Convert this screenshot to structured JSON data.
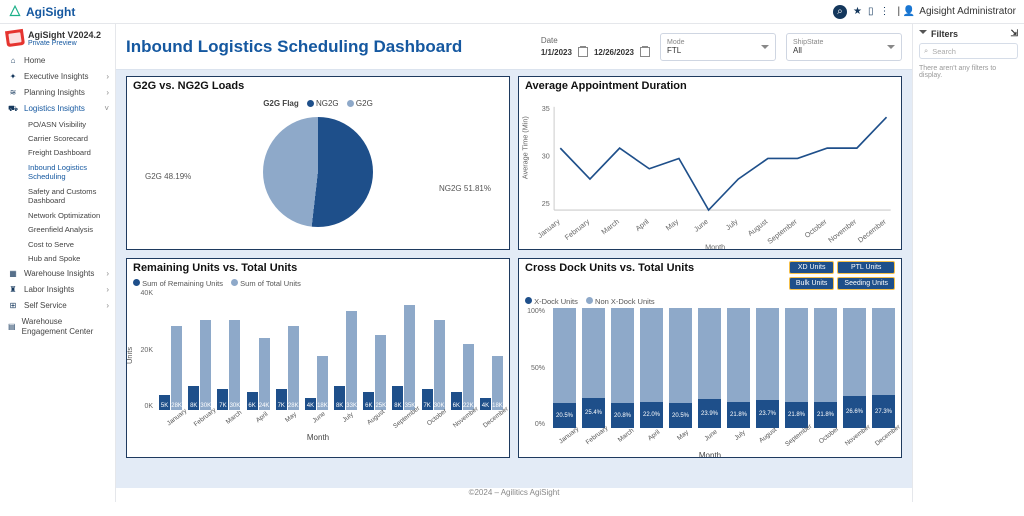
{
  "brand": "AgiSight",
  "user": "Agisight Administrator",
  "app": {
    "name": "AgiSight V2024.2",
    "sub": "Private Preview"
  },
  "nav": {
    "items": [
      {
        "label": "Home",
        "icon": "⌂"
      },
      {
        "label": "Executive Insights",
        "icon": "✦",
        "exp": true
      },
      {
        "label": "Planning Insights",
        "icon": "≋",
        "exp": true
      },
      {
        "label": "Logistics Insights",
        "icon": "⛟",
        "exp": true,
        "active": true,
        "children": [
          {
            "label": "PO/ASN Visibility"
          },
          {
            "label": "Carrier Scorecard"
          },
          {
            "label": "Freight Dashboard"
          },
          {
            "label": "Inbound Logistics Scheduling",
            "sel": true
          },
          {
            "label": "Safety and Customs Dashboard"
          },
          {
            "label": "Network Optimization"
          },
          {
            "label": "Greenfield Analysis"
          },
          {
            "label": "Cost to Serve"
          },
          {
            "label": "Hub and Spoke"
          }
        ]
      },
      {
        "label": "Warehouse Insights",
        "icon": "▦",
        "exp": true
      },
      {
        "label": "Labor Insights",
        "icon": "♜",
        "exp": true
      },
      {
        "label": "Self Service",
        "icon": "⊞",
        "exp": true
      },
      {
        "label": "Warehouse Engagement Center",
        "icon": "▤"
      }
    ]
  },
  "header": {
    "title": "Inbound Logistics Scheduling Dashboard",
    "date_label": "Date",
    "date_from": "1/1/2023",
    "date_to": "12/26/2023",
    "mode": {
      "label": "Mode",
      "value": "FTL"
    },
    "shipstate": {
      "label": "ShipState",
      "value": "All"
    }
  },
  "filters": {
    "title": "Filters",
    "search_ph": "Search",
    "empty": "There aren't any filters to display."
  },
  "months": [
    "January",
    "February",
    "March",
    "April",
    "May",
    "June",
    "July",
    "August",
    "September",
    "October",
    "November",
    "December"
  ],
  "chart_data": [
    {
      "type": "pie",
      "title": "G2G vs. NG2G Loads",
      "legend_title": "G2G Flag",
      "series": [
        {
          "name": "NG2G",
          "value": 51.81,
          "label": "NG2G 51.81%"
        },
        {
          "name": "G2G",
          "value": 48.19,
          "label": "G2G 48.19%"
        }
      ]
    },
    {
      "type": "line",
      "title": "Average Appointment Duration",
      "xlabel": "Month",
      "ylabel": "Average Time (Min)",
      "ylim": [
        25,
        35
      ],
      "values": [
        31,
        28,
        31,
        29,
        30,
        25,
        28,
        30,
        30,
        31,
        31,
        34
      ]
    },
    {
      "type": "bar",
      "title": "Remaining Units vs. Total Units",
      "xlabel": "Month",
      "ylabel": "Units",
      "ylim": [
        0,
        40000
      ],
      "yticks": [
        "40K",
        "20K",
        "0K"
      ],
      "legend": [
        "Sum of Remaining Units",
        "Sum of Total Units"
      ],
      "series": [
        {
          "name": "Sum of Remaining Units",
          "values": [
            5000,
            8000,
            7000,
            6000,
            7000,
            4000,
            8000,
            6000,
            8000,
            7000,
            6000,
            4000
          ],
          "labels": [
            "5K",
            "8K",
            "7K",
            "6K",
            "7K",
            "4K",
            "8K",
            "6K",
            "8K",
            "7K",
            "6K",
            "4K"
          ]
        },
        {
          "name": "Sum of Total Units",
          "values": [
            28000,
            30000,
            30000,
            24000,
            28000,
            18000,
            33000,
            25000,
            35000,
            30000,
            22000,
            18000
          ],
          "labels": [
            "28K",
            "30K",
            "30K",
            "24K",
            "28K",
            "18K",
            "33K",
            "25K",
            "35K",
            "30K",
            "22K",
            "18K"
          ]
        }
      ]
    },
    {
      "type": "bar",
      "title": "Cross Dock Units vs. Total Units",
      "xlabel": "Month",
      "ylabel": "",
      "ylim": [
        0,
        100
      ],
      "yticks": [
        "100%",
        "50%",
        "0%"
      ],
      "legend": [
        "X-Dock Units",
        "Non X-Dock Units"
      ],
      "buttons": [
        "XD Units",
        "PTL Units",
        "Bulk Units",
        "Seeding Units"
      ],
      "series": [
        {
          "name": "X-Dock %",
          "values": [
            20.5,
            25.4,
            20.8,
            22.0,
            20.5,
            23.9,
            21.8,
            23.7,
            21.8,
            21.8,
            26.6,
            27.3
          ],
          "labels": [
            "20.5%",
            "25.4%",
            "20.8%",
            "22.0%",
            "20.5%",
            "23.9%",
            "21.8%",
            "23.7%",
            "21.8%",
            "21.8%",
            "26.6%",
            "27.3%"
          ]
        }
      ]
    }
  ],
  "footer": "©2024 – Agilitics AgiSight"
}
